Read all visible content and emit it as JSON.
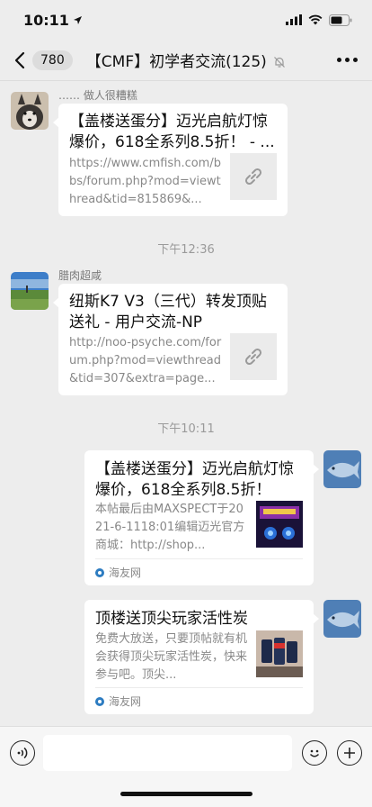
{
  "status_bar": {
    "time": "10:11"
  },
  "nav": {
    "unread_count": "780",
    "title": "【CMF】初学者交流(125)"
  },
  "messages": [
    {
      "sender": "…… 做人很糟糕",
      "title": "【盖楼送蛋分】迈光启航灯惊爆价，618全系列8.5折！ - ...",
      "desc": "https://www.cmfish.com/bbs/forum.php?mod=viewthread&tid=815869&..."
    },
    {
      "sender": "腊肉超咸",
      "title": "纽斯K7 V3（三代）转发顶贴送礼 - 用户交流-NP",
      "desc": "http://noo-psyche.com/forum.php?mod=viewthread&tid=307&extra=page..."
    },
    {
      "title": "【盖楼送蛋分】迈光启航灯惊爆价，618全系列8.5折！",
      "desc": "本帖最后由MAXSPECT于2021-6-1118:01编辑迈光官方商城：http://shop...",
      "source": "海友网"
    },
    {
      "title": "顶楼送顶尖玩家活性炭",
      "desc": "免费大放送，只要顶帖就有机会获得顶尖玩家活性炭，快来参与吧。顶尖...",
      "source": "海友网"
    }
  ],
  "timestamps": [
    "下午12:36",
    "下午10:11"
  ],
  "colors": {
    "background": "#ededed",
    "bubble": "#ffffff",
    "source_icon": "#2d7cc1"
  }
}
